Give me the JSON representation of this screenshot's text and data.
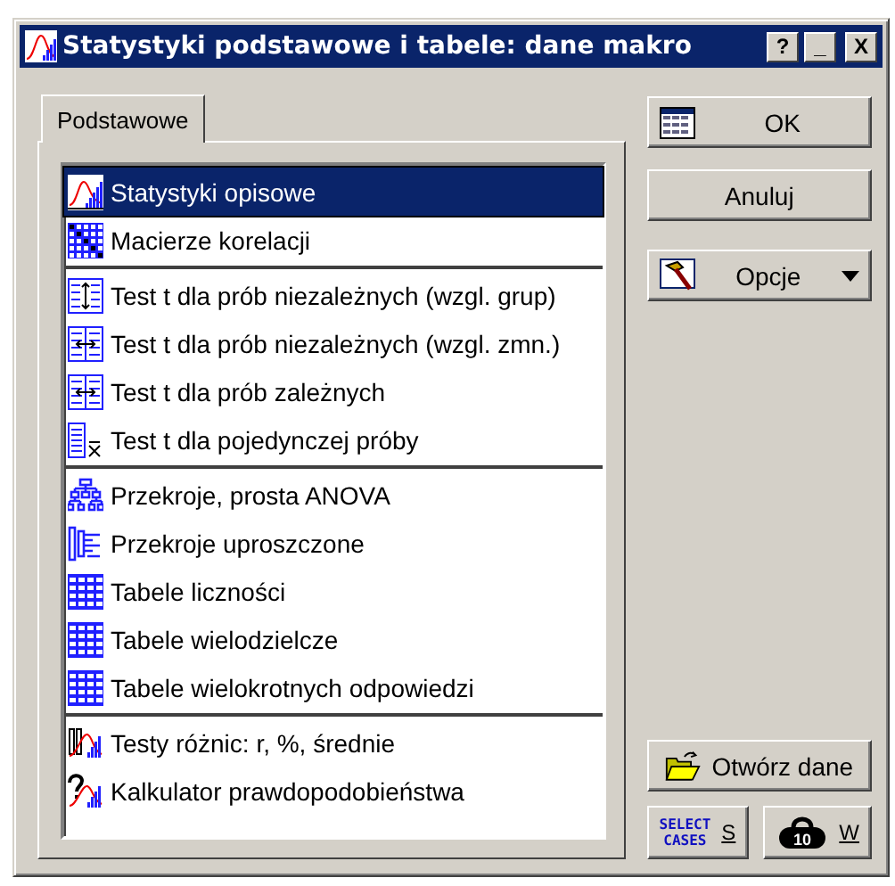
{
  "window": {
    "title": "Statystyki podstawowe i tabele: dane makro",
    "controls": [
      "?",
      "_",
      "X"
    ]
  },
  "tabs": [
    {
      "label": "Podstawowe",
      "selected": true
    }
  ],
  "groups": [
    {
      "items": [
        {
          "label": "Statystyki opisowe",
          "kind": "stats",
          "selected": true
        },
        {
          "label": "Macierze korelacji",
          "kind": "matrix",
          "selected": false
        }
      ]
    },
    {
      "items": [
        {
          "label": "Test t dla prób niezależnych (wzgl. grup)",
          "kind": "vtest",
          "selected": false
        },
        {
          "label": "Test t dla prób niezależnych (wzgl. zmn.)",
          "kind": "htest",
          "selected": false
        },
        {
          "label": "Test t dla prób zależnych",
          "kind": "htest",
          "selected": false
        },
        {
          "label": "Test t dla pojedynczej próby",
          "kind": "mean",
          "selected": false
        }
      ]
    },
    {
      "items": [
        {
          "label": "Przekroje, prosta ANOVA",
          "kind": "tree",
          "selected": false
        },
        {
          "label": "Przekroje uproszczone",
          "kind": "branch",
          "selected": false
        },
        {
          "label": "Tabele liczności",
          "kind": "table",
          "selected": false
        },
        {
          "label": "Tabele wielodzielcze",
          "kind": "table",
          "selected": false
        },
        {
          "label": "Tabele wielokrotnych odpowiedzi",
          "kind": "table",
          "selected": false
        }
      ]
    },
    {
      "items": [
        {
          "label": "Testy różnic: r, %, średnie",
          "kind": "diff",
          "selected": false
        },
        {
          "label": "Kalkulator prawdopodobieństwa",
          "kind": "prob",
          "selected": false
        }
      ]
    }
  ],
  "buttons": {
    "ok": "OK",
    "cancel": "Anuluj",
    "options": "Opcje",
    "open": "Otwórz dane",
    "select_cases": {
      "icon_text": [
        "SELECT",
        "CASES"
      ],
      "label": "S"
    },
    "weight": {
      "icon_text": "10",
      "label": "W"
    }
  }
}
